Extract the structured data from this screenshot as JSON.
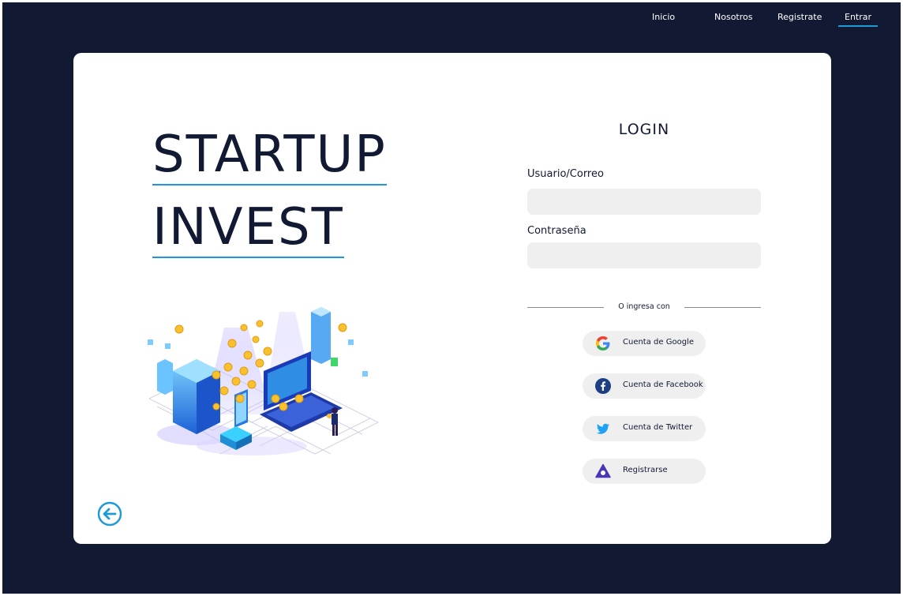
{
  "nav": {
    "items": [
      {
        "label": "Inicio"
      },
      {
        "label": "Nosotros"
      },
      {
        "label": "Registrate"
      },
      {
        "label": "Entrar",
        "active": true
      }
    ]
  },
  "brand": {
    "line1": "STARTUP",
    "line2": "INVEST"
  },
  "login": {
    "title": "LOGIN",
    "user_label": "Usuario/Correo",
    "user_value": "",
    "password_label": "Contraseña",
    "password_value": "",
    "divider_text": "O ingresa con"
  },
  "social": [
    {
      "label": "Cuenta de Google",
      "icon": "google-icon"
    },
    {
      "label": "Cuenta de Facebook",
      "icon": "facebook-icon"
    },
    {
      "label": "Cuenta de Twitter",
      "icon": "twitter-icon"
    },
    {
      "label": "Registrarse",
      "icon": "triangle-logo-icon"
    }
  ],
  "back_button": {
    "icon": "arrow-left-circle-icon"
  },
  "colors": {
    "background": "#121a33",
    "card": "#ffffff",
    "accent": "#1e9bd7",
    "input": "#efefef",
    "text": "#121a33"
  }
}
